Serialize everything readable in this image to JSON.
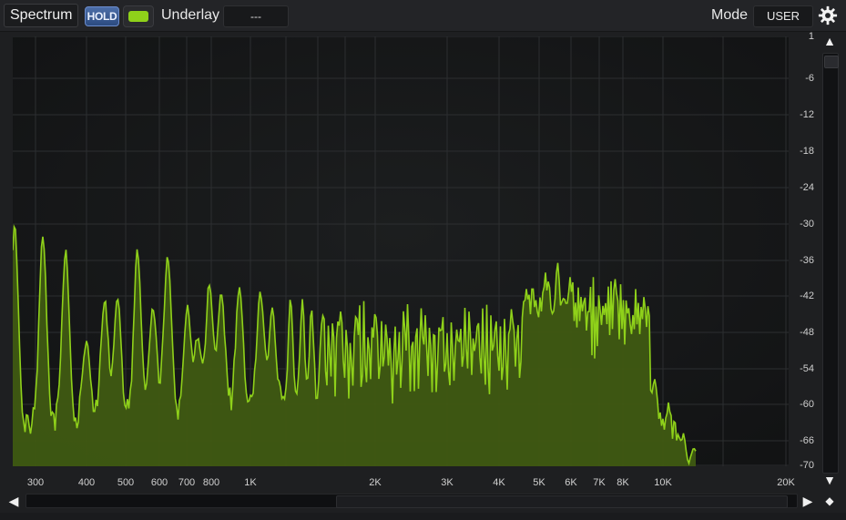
{
  "toolbar": {
    "title": "Spectrum",
    "hold_label": "HOLD",
    "underlay_label": "Underlay",
    "underlay_value": "---",
    "mode_label": "Mode",
    "mode_value": "USER"
  },
  "colors": {
    "accent_green": "#8fd11a",
    "fill_green": "#3f5a12",
    "grid": "#2c2e30"
  },
  "icons": {
    "settings": "gear-icon",
    "scroll_up": "triangle-up-icon",
    "scroll_down": "triangle-down-icon",
    "scroll_left": "triangle-left-icon",
    "scroll_right": "triangle-right-icon",
    "reset": "diamond-icon"
  },
  "axis": {
    "x_labels": [
      "300",
      "400",
      "500",
      "600",
      "700",
      "800",
      "1K",
      "2K",
      "3K",
      "4K",
      "5K",
      "6K",
      "7K",
      "8K",
      "10K",
      "20K"
    ],
    "y_labels": [
      "1",
      "-6",
      "-12",
      "-18",
      "-24",
      "-30",
      "-36",
      "-42",
      "-48",
      "-54",
      "-60",
      "-66",
      "-70"
    ]
  },
  "glyphs": {
    "up": "▲",
    "down": "▼",
    "left": "◀",
    "right": "▶",
    "diamond": "◆"
  }
}
